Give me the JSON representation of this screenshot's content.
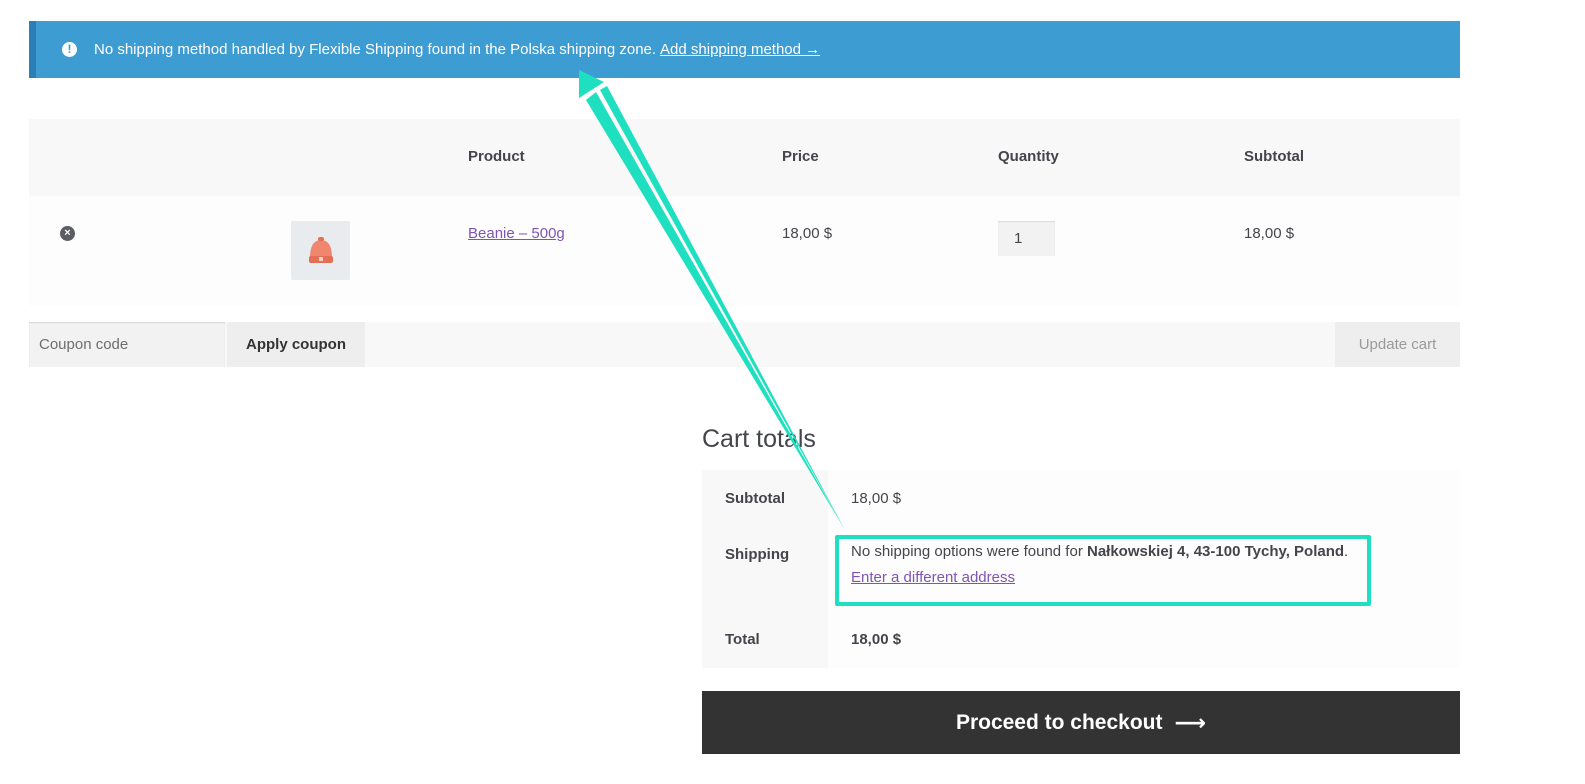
{
  "notice": {
    "text": "No shipping method handled by Flexible Shipping found in the Polska shipping zone.",
    "link": "Add shipping method →",
    "icon": "exclamation-circle-icon"
  },
  "cart": {
    "headers": {
      "product": "Product",
      "price": "Price",
      "quantity": "Quantity",
      "subtotal": "Subtotal"
    },
    "items": [
      {
        "name": "Beanie – 500g",
        "price": "18,00 $",
        "quantity": "1",
        "subtotal": "18,00 $",
        "remove_icon": "remove-circle-icon"
      }
    ],
    "coupon_placeholder": "Coupon code",
    "apply_coupon": "Apply coupon",
    "update_cart": "Update cart"
  },
  "totals": {
    "title": "Cart totals",
    "subtotal_label": "Subtotal",
    "subtotal_value": "18,00 $",
    "shipping_label": "Shipping",
    "shipping_text_prefix": "No shipping options were found for",
    "shipping_address": "Nałkowskiej 4, 43-100 Tychy, Poland",
    "shipping_text_suffix": ".",
    "shipping_link": "Enter a different address",
    "total_label": "Total",
    "total_value": "18,00 $"
  },
  "checkout": {
    "label": "Proceed to checkout",
    "arrow": "⟶"
  },
  "colors": {
    "notice_bg": "#3d9cd2",
    "accent_link": "#7f54b3",
    "annotation": "#1ee0c0",
    "checkout_bg": "#333333"
  }
}
